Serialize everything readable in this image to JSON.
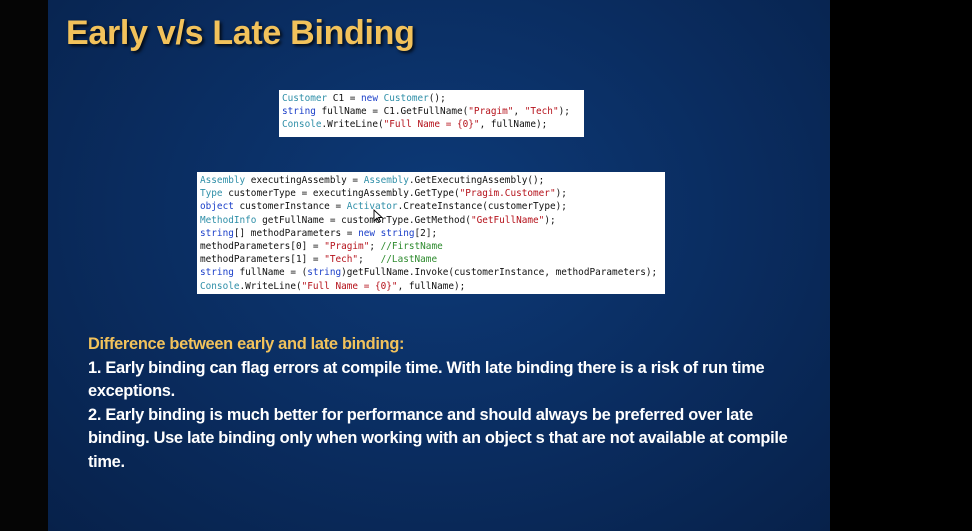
{
  "slide": {
    "title": "Early v/s Late Binding",
    "colors": {
      "title": "#f2c25b",
      "background": "#0a2c5f",
      "body_text": "#ffffff"
    }
  },
  "early_binding_code": {
    "lines": [
      "Customer C1 = new Customer();",
      "string fullName = C1.GetFullName(\"Pragim\", \"Tech\");",
      "Console.WriteLine(\"Full Name = {0}\", fullName);"
    ]
  },
  "late_binding_code": {
    "lines": [
      "Assembly executingAssembly = Assembly.GetExecutingAssembly();",
      "Type customerType = executingAssembly.GetType(\"Pragim.Customer\");",
      "object customerInstance = Activator.CreateInstance(customerType);",
      "MethodInfo getFullName = customerType.GetMethod(\"GetFullName\");",
      "string[] methodParameters = new string[2];",
      "methodParameters[0] = \"Pragim\"; //FirstName",
      "methodParameters[1] = \"Tech\";   //LastName",
      "string fullName = (string)getFullName.Invoke(customerInstance, methodParameters);",
      "Console.WriteLine(\"Full Name = {0}\", fullName);"
    ]
  },
  "difference": {
    "heading": "Difference between early and late binding:",
    "point1": "1. Early binding can flag errors at compile time. With late binding there is a risk of run time exceptions.",
    "point2": "2. Early binding is much better for performance and should always be preferred over late binding. Use late binding only when working with an object s that are not available at compile time."
  }
}
